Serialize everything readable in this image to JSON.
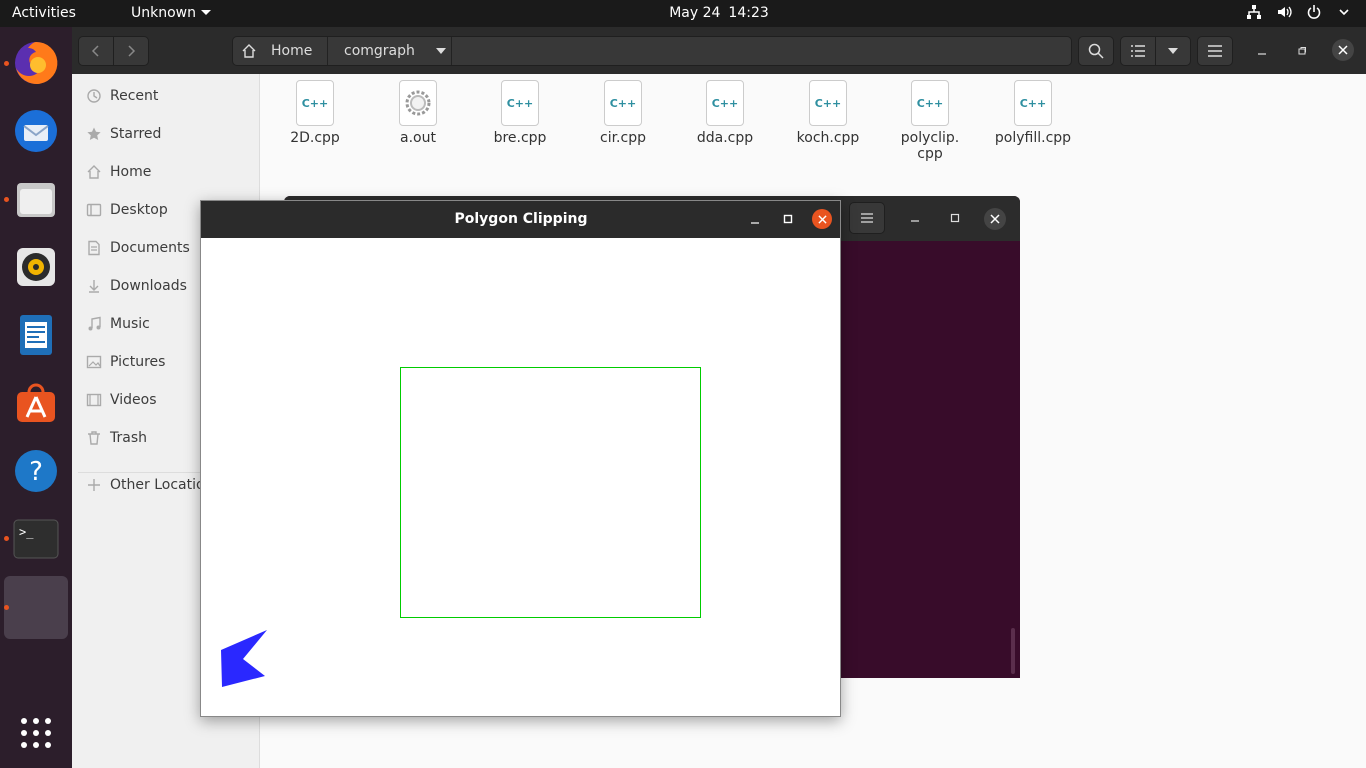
{
  "topbar": {
    "activities": "Activities",
    "app_menu": "Unknown",
    "date": "May 24",
    "time": "14:23"
  },
  "dock": {
    "apps": [
      {
        "name": "firefox",
        "running": true
      },
      {
        "name": "thunderbird",
        "running": false
      },
      {
        "name": "files",
        "running": true
      },
      {
        "name": "rhythmbox",
        "running": false
      },
      {
        "name": "libreoffice-writer",
        "running": false
      },
      {
        "name": "software",
        "running": false
      },
      {
        "name": "help",
        "running": false
      },
      {
        "name": "terminal",
        "running": true
      },
      {
        "name": "polygon-app",
        "running": true
      }
    ]
  },
  "files": {
    "path": [
      "Home",
      "comgraph"
    ],
    "sidebar": [
      "Recent",
      "Starred",
      "Home",
      "Desktop",
      "Documents",
      "Downloads",
      "Music",
      "Pictures",
      "Videos",
      "Trash",
      "Other Locations"
    ],
    "items": [
      {
        "name": "2D.cpp",
        "icon": "C++"
      },
      {
        "name": "a.out",
        "icon": "gear"
      },
      {
        "name": "bre.cpp",
        "icon": "C++"
      },
      {
        "name": "cir.cpp",
        "icon": "C++"
      },
      {
        "name": "dda.cpp",
        "icon": "C++"
      },
      {
        "name": "koch.cpp",
        "icon": "C++"
      },
      {
        "name": "polyclip.",
        "name2": "cpp",
        "icon": "C++"
      },
      {
        "name": "polyfill.cpp",
        "icon": "C++"
      }
    ]
  },
  "poly_window": {
    "title": "Polygon Clipping"
  },
  "colors": {
    "accent": "#e95420",
    "clip_window": "#00cc00",
    "polygon_fill": "#2a28ff",
    "terminal_bg": "#380c2a"
  }
}
